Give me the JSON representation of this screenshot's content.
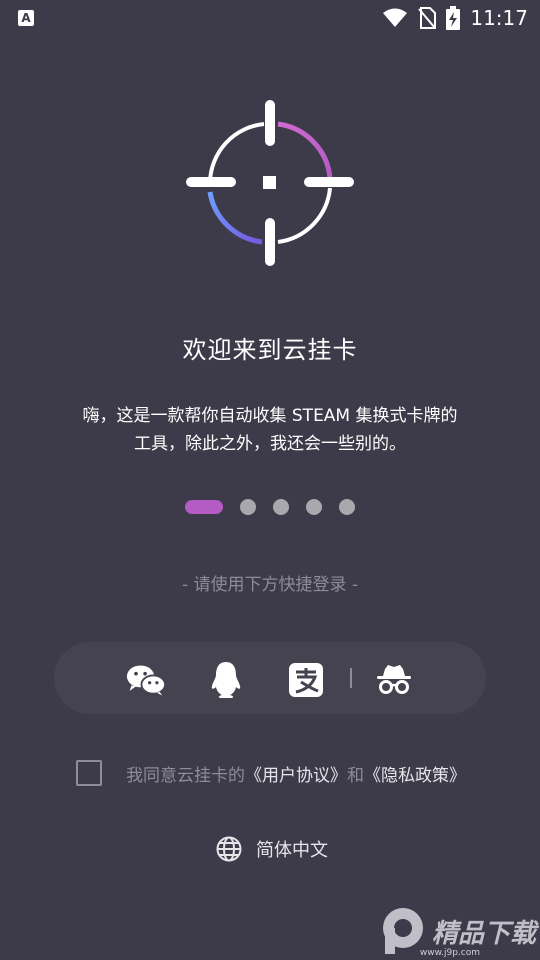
{
  "status_bar": {
    "app_icon_letter": "A",
    "time": "11:17",
    "icons": [
      "wifi-icon",
      "no-sim-icon",
      "battery-charging-icon"
    ]
  },
  "onboarding": {
    "title": "欢迎来到云挂卡",
    "description_line1": "嗨，这是一款帮你自动收集 STEAM 集换式卡牌的",
    "description_line2": "工具，除此之外，我还会一些别的。",
    "page_indicator": {
      "total": 5,
      "active_index": 0,
      "active_color": "#b55bc4"
    }
  },
  "login": {
    "hint": "- 请使用下方快捷登录 -",
    "options": [
      {
        "name": "wechat-login-icon"
      },
      {
        "name": "qq-login-icon"
      },
      {
        "name": "alipay-login-icon"
      },
      {
        "name": "guest-login-icon"
      }
    ]
  },
  "agreement": {
    "prefix": "我同意云挂卡的",
    "user_agreement": "《用户协议》",
    "and": "和",
    "privacy_policy": "《隐私政策》",
    "checked": false
  },
  "language": {
    "label": "简体中文"
  },
  "watermark": {
    "brand": "精品下载",
    "url": "www.j9p.com"
  },
  "colors": {
    "background": "#3d3b49",
    "accent_purple": "#b55bc4",
    "accent_blue": "#6b63e8"
  }
}
